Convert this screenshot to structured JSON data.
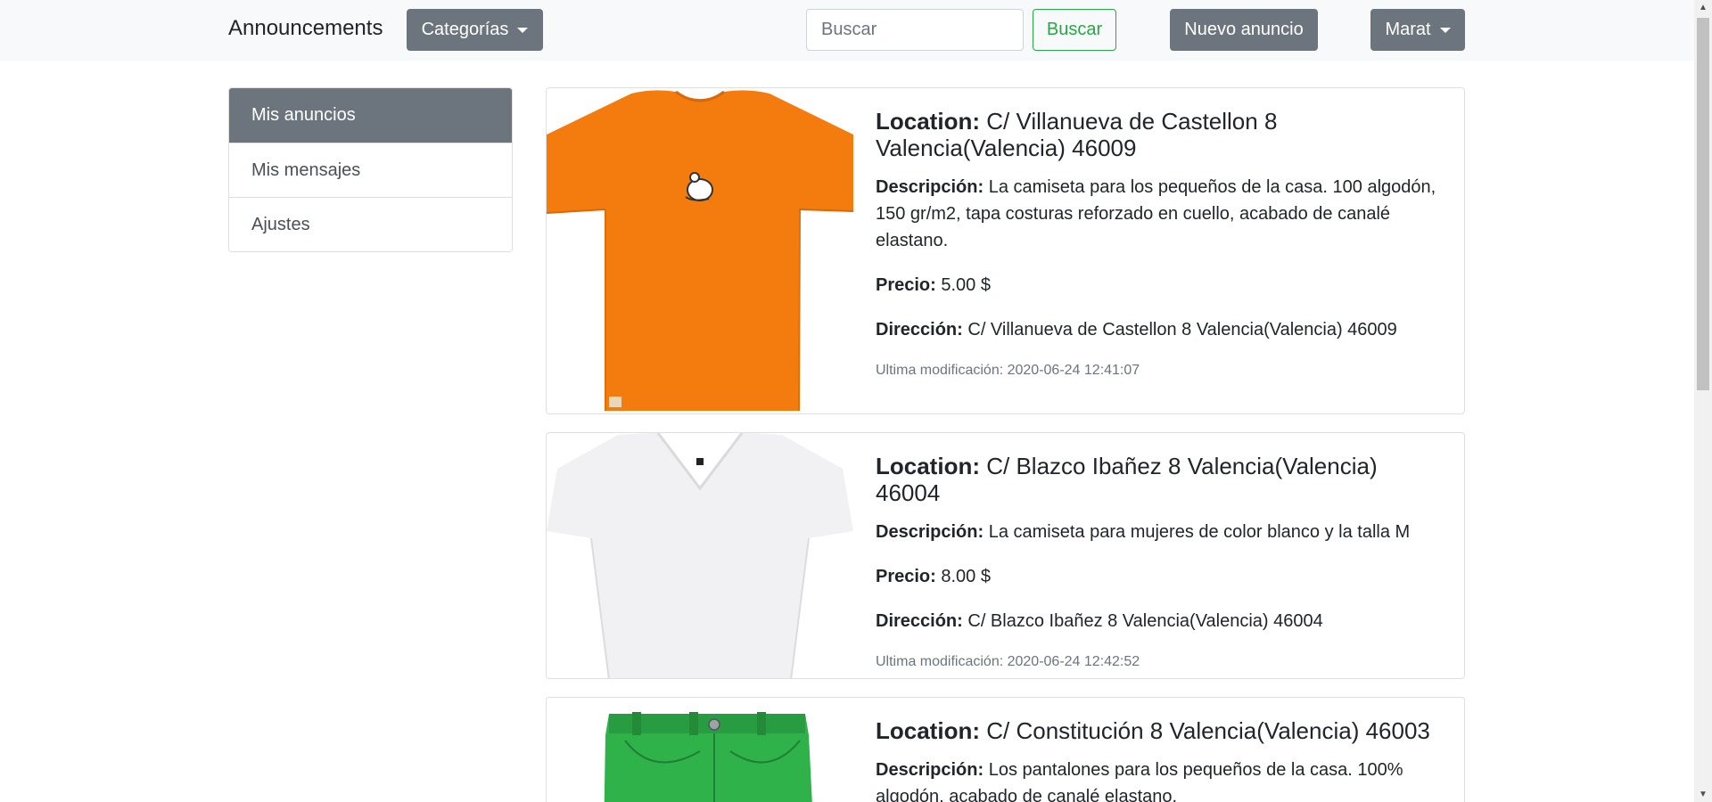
{
  "navbar": {
    "brand": "Announcements",
    "categories_label": "Categorías",
    "search_placeholder": "Buscar",
    "search_button": "Buscar",
    "new_ad_button": "Nuevo anuncio",
    "user_menu": "Marat"
  },
  "sidebar": {
    "items": [
      {
        "label": "Mis anuncios",
        "active": true
      },
      {
        "label": "Mis mensajes",
        "active": false
      },
      {
        "label": "Ajustes",
        "active": false
      }
    ]
  },
  "labels": {
    "location": "Location:",
    "description": "Descripción:",
    "price": "Precio:",
    "address": "Dirección:"
  },
  "ads": [
    {
      "image": "orange-tshirt-image",
      "location": "C/ Villanueva de Castellon 8 Valencia(Valencia) 46009",
      "description": "La camiseta para los pequeños de la casa. 100 algodón, 150 gr/m2, tapa costuras reforzado en cuello, acabado de canalé elastano.",
      "price": "5.00 $",
      "address": "C/ Villanueva de Castellon 8 Valencia(Valencia) 46009",
      "modified": "Ultima modificación: 2020-06-24 12:41:07"
    },
    {
      "image": "white-tshirt-image",
      "location": "C/ Blazco Ibañez 8 Valencia(Valencia) 46004",
      "description": "La camiseta para mujeres de color blanco y la talla M",
      "price": "8.00 $",
      "address": "C/ Blazco Ibañez 8 Valencia(Valencia) 46004",
      "modified": "Ultima modificación: 2020-06-24 12:42:52"
    },
    {
      "image": "green-pants-image",
      "location": "C/ Constitución 8 Valencia(Valencia) 46003",
      "description": "Los pantalones para los pequeños de la casa. 100% algodón, acabado de canalé elastano."
    }
  ],
  "colors": {
    "secondary": "#6c757d",
    "success": "#28a745",
    "navbar_bg": "#f8f9fa",
    "orange_shirt": "#f47c0e",
    "green_pants": "#2fb24a"
  }
}
